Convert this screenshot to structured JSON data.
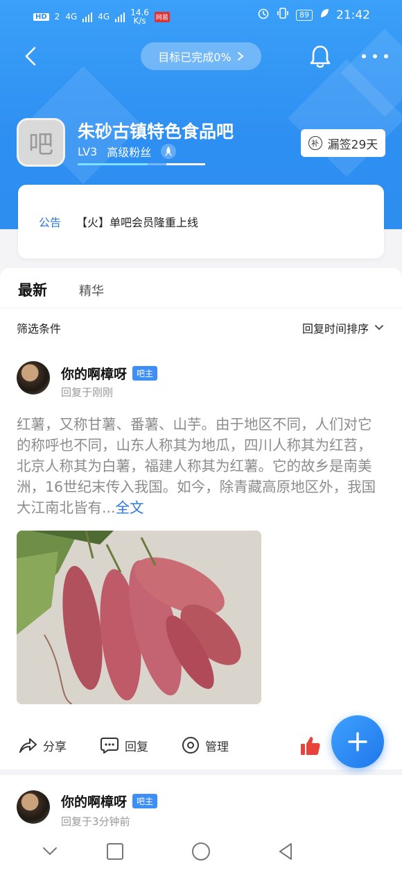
{
  "status_bar": {
    "hd": "HD",
    "sim": "2",
    "net1": "4G",
    "net2": "4G",
    "speed": "14.6",
    "speed_unit": "K/s",
    "app_badge": "网易",
    "battery": "89",
    "time": "21:42"
  },
  "topbar": {
    "goal_text": "目标已完成0%"
  },
  "forum": {
    "avatar_char": "吧",
    "name": "朱砂古镇特色食品吧",
    "level": "LV3",
    "level_title": "高级粉丝",
    "progress_fraction": 0.55,
    "sign_label": "漏签29天",
    "sign_icon_char": "补"
  },
  "notice": {
    "label": "公告",
    "text": "【火】单吧会员隆重上线"
  },
  "tabs": {
    "latest": "最新",
    "featured": "精华"
  },
  "filter": {
    "label": "筛选条件",
    "sort": "回复时间排序"
  },
  "posts": [
    {
      "author": "你的啊樟呀",
      "badge": "吧主",
      "time": "回复于刚刚",
      "body": "红薯，又称甘薯、番薯、山芋。由于地区不同，人们对它的称呼也不同，山东人称其为地瓜，四川人称其为红苕，北京人称其为白薯，福建人称其为红薯。它的故乡是南美洲，16世纪末传入我国。如今，除青藏高原地区外，我国大江南北皆有...",
      "more": "全文"
    },
    {
      "author": "你的啊樟呀",
      "badge": "吧主",
      "time": "回复于3分钟前"
    }
  ],
  "actions": {
    "share": "分享",
    "reply": "回复",
    "manage": "管理"
  },
  "colors": {
    "header_blue": "#2e8ff2",
    "link_blue": "#2e78d8",
    "badge_blue": "#3e8ef7",
    "like_red": "#e8423b"
  }
}
